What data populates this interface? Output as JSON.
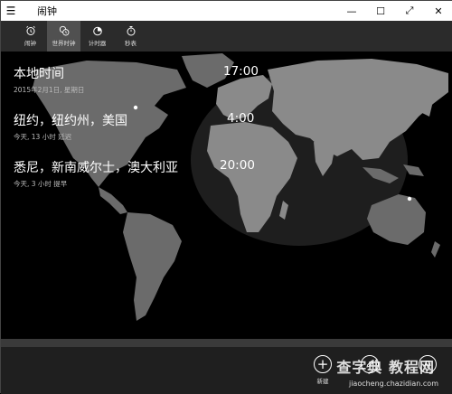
{
  "window": {
    "title": "闹钟",
    "menu_icon": "hamburger-icon",
    "minimize": "—",
    "maximize": "☐",
    "restore": "⤢",
    "close": "✕"
  },
  "tabs": [
    {
      "label": "闹钟",
      "icon": "alarm-clock-icon"
    },
    {
      "label": "世界时钟",
      "icon": "world-clock-icon"
    },
    {
      "label": "计时器",
      "icon": "timer-icon"
    },
    {
      "label": "秒表",
      "icon": "stopwatch-icon"
    }
  ],
  "clocks": [
    {
      "city": "本地时间",
      "detail": "2015年2月1日, 星期日",
      "time": "17:00"
    },
    {
      "city": "纽约，纽约州，美国",
      "detail": "今天, 13 小时 延迟",
      "time": "4:00"
    },
    {
      "city": "悉尼，新南威尔士，澳大利亚",
      "detail": "今天, 3 小时 提早",
      "time": "20:00"
    }
  ],
  "bottom": {
    "new_label": "新建",
    "new_icon": "plus-icon",
    "edit_icon": "edit-icon",
    "pin_icon": "pin-icon"
  },
  "watermark": {
    "text": "查字典 教程网",
    "url": "jiaocheng.chazidian.com"
  },
  "colors": {
    "land": "#6b6b6b",
    "daylight_land": "#8a8a8a",
    "background": "#000000",
    "tabbar": "#2b2b2b",
    "active_tab": "#505050"
  }
}
